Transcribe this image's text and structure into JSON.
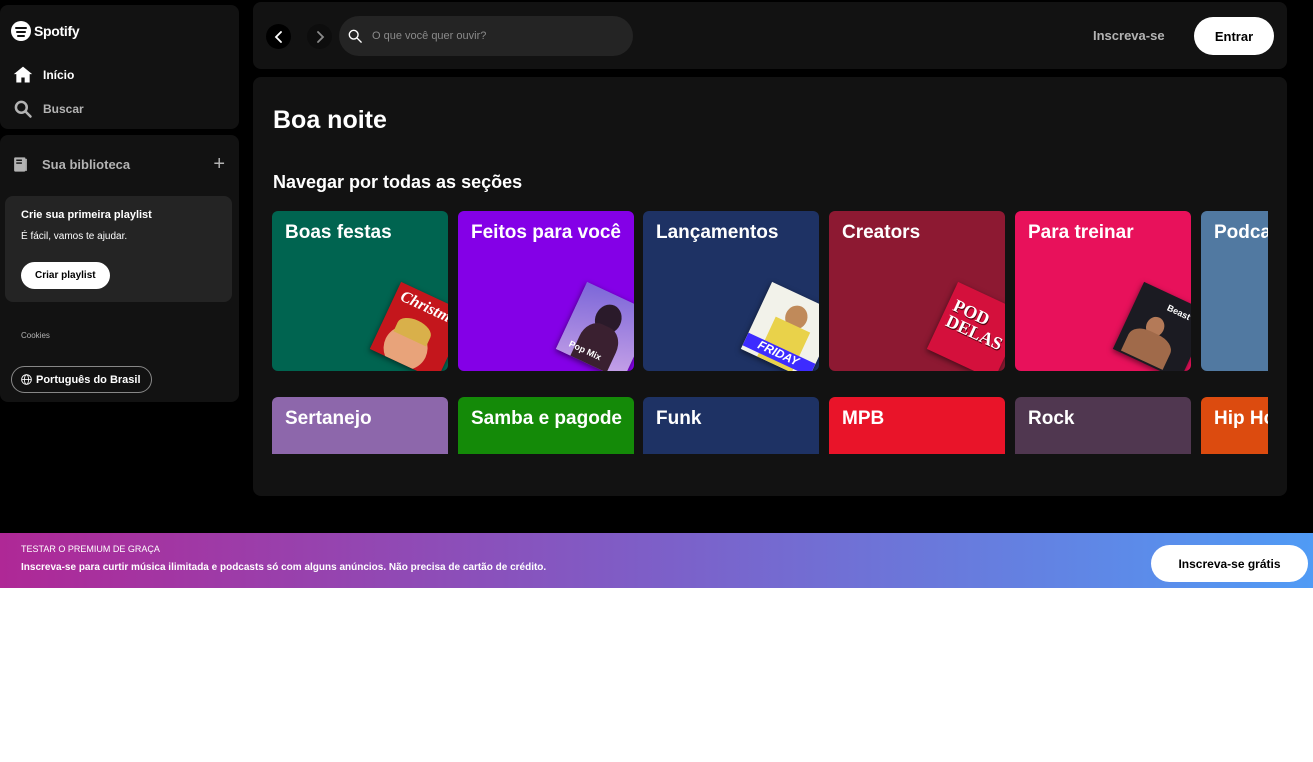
{
  "sidebar": {
    "logo_text": "Spotify",
    "nav": [
      {
        "label": "Início",
        "icon": "home-icon"
      },
      {
        "label": "Buscar",
        "icon": "search-icon"
      }
    ],
    "library": {
      "label": "Sua biblioteca",
      "add_label": "+",
      "promo_card": {
        "title": "Crie sua primeira playlist",
        "subtitle": "É fácil, vamos te ajudar.",
        "button_label": "Criar playlist"
      },
      "cookies_label": "Cookies",
      "language_label": "Português do Brasil"
    }
  },
  "topbar": {
    "search_placeholder": "O que você quer ouvir?",
    "signup_label": "Inscreva-se",
    "login_label": "Entrar"
  },
  "main": {
    "greeting": "Boa noite",
    "section_title": "Navegar por todas as seções",
    "cards_row1": [
      {
        "title": "Boas festas",
        "color": "#006450",
        "art": "Christmas Hits"
      },
      {
        "title": "Feitos para você",
        "color": "#8400e7",
        "art": "Pop Mix"
      },
      {
        "title": "Lançamentos",
        "color": "#1e3264",
        "art": "FRIDAY"
      },
      {
        "title": "Creators",
        "color": "#8d1932",
        "art": "POD DELAS"
      },
      {
        "title": "Para treinar",
        "color": "#e8115b",
        "art": "Beast Mode"
      },
      {
        "title": "Podcasts",
        "color": "#5179a1",
        "art": ""
      }
    ],
    "cards_row2": [
      {
        "title": "Sertanejo",
        "color": "#8d67ab"
      },
      {
        "title": "Samba e pagode",
        "color": "#148a08"
      },
      {
        "title": "Funk",
        "color": "#1e3264"
      },
      {
        "title": "MPB",
        "color": "#e91429"
      },
      {
        "title": "Rock",
        "color": "#503750"
      },
      {
        "title": "Hip Hop",
        "color": "#dc4b0f"
      }
    ]
  },
  "banner": {
    "kicker": "TESTAR O PREMIUM DE GRAÇA",
    "text": "Inscreva-se para curtir música ilimitada e podcasts só com alguns anúncios. Não precisa de cartão de crédito.",
    "button_label": "Inscreva-se grátis"
  }
}
